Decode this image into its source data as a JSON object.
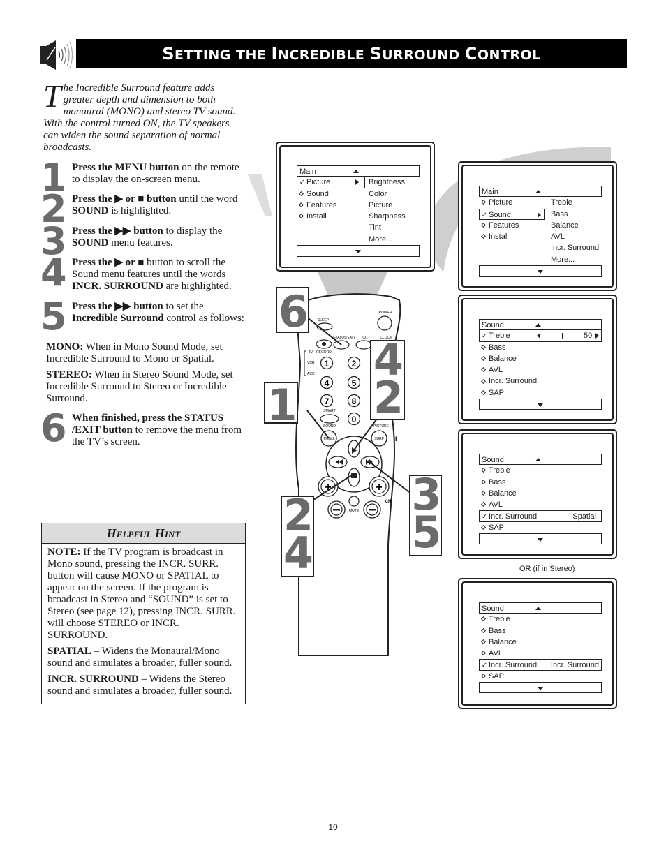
{
  "header": {
    "icon": "speaker-icon",
    "title_parts": [
      {
        "big": "S",
        "rest": "ETTING THE "
      },
      {
        "big": "I",
        "rest": "NCREDIBLE "
      },
      {
        "big": "S",
        "rest": "URROUND "
      },
      {
        "big": "C",
        "rest": "ONTROL"
      }
    ],
    "title": "Setting the Incredible Surround Control"
  },
  "intro": {
    "dropcap": "T",
    "text": "he Incredible Surround feature adds greater depth and dimension to both monaural (MONO) and stereo TV sound. With the control turned ON, the TV speakers can widen the sound separation of normal broadcasts."
  },
  "steps": [
    {
      "num": "1",
      "bold": "Press the MENU button",
      "rest": " on the remote to display the on-screen menu."
    },
    {
      "num": "2",
      "bold": "Press the ▶ or ■ button",
      "rest": " until the word ",
      "bold2": "SOUND",
      "rest2": " is highlighted."
    },
    {
      "num": "3",
      "bold": "Press the ▶▶ button",
      "rest": " to display the ",
      "bold2": "SOUND",
      "rest2": " menu features."
    },
    {
      "num": "4",
      "bold": "Press the ▶ or ■",
      "rest": " button to scroll the Sound menu features until the words ",
      "bold2": "INCR. SURROUND",
      "rest2": " are highlighted."
    },
    {
      "num": "5",
      "bold": "Press the ▶▶ button",
      "rest": " to set the ",
      "bold2": "Incredible Surround",
      "rest2": " control as follows:"
    },
    {
      "num": "6",
      "bold": "When finished, press the STATUS /EXIT button",
      "rest": " to remove the menu from the TV’s screen."
    }
  ],
  "modes": [
    {
      "label": "MONO:",
      "text": " When in Mono Sound Mode, set Incredible Surround to Mono or Spatial."
    },
    {
      "label": "STEREO:",
      "text": " When in Stereo Sound Mode, set Incredible Surround to Stereo or Incredible Surround."
    }
  ],
  "hint": {
    "title": "Helpful Hint",
    "note_label": "NOTE:",
    "note_text": "  If the TV program is broadcast in Mono sound, pressing the INCR. SURR. button will cause MONO or SPATIAL to appear on the screen. If the program is broadcast in Stereo and “SOUND” is set to Stereo (see page 12), pressing INCR. SURR. will choose STEREO or INCR. SURROUND.",
    "spatial_label": "SPATIAL",
    "spatial_text": " – Widens the Monaural/Mono sound and simulates a broader, fuller sound.",
    "incr_label": "INCR. SURROUND",
    "incr_text": " – Widens the Stereo sound and simulates a broader, fuller sound."
  },
  "screens": {
    "s1": {
      "header": "Main",
      "left": [
        {
          "label": "Picture",
          "mark": "check",
          "selected": true
        },
        {
          "label": "Sound",
          "mark": "diamond"
        },
        {
          "label": "Features",
          "mark": "diamond"
        },
        {
          "label": "Install",
          "mark": "diamond"
        }
      ],
      "right": [
        "Brightness",
        "Color",
        "Picture",
        "Sharpness",
        "Tint",
        "More..."
      ]
    },
    "s2": {
      "header": "Main",
      "left": [
        {
          "label": "Picture",
          "mark": "diamond"
        },
        {
          "label": "Sound",
          "mark": "check",
          "selected": true
        },
        {
          "label": "Features",
          "mark": "diamond"
        },
        {
          "label": "Install",
          "mark": "diamond"
        }
      ],
      "right": [
        "Treble",
        "Bass",
        "Balance",
        "AVL",
        "Incr. Surround",
        "More..."
      ]
    },
    "s3": {
      "header": "Sound",
      "items": [
        {
          "label": "Treble",
          "mark": "check",
          "selected": true,
          "slider_value": "50",
          "slider_fraction": 0.5
        },
        {
          "label": "Bass",
          "mark": "diamond"
        },
        {
          "label": "Balance",
          "mark": "diamond"
        },
        {
          "label": "AVL",
          "mark": "diamond"
        },
        {
          "label": "Incr. Surround",
          "mark": "diamond"
        },
        {
          "label": "SAP",
          "mark": "diamond"
        }
      ]
    },
    "s4": {
      "header": "Sound",
      "items": [
        {
          "label": "Treble",
          "mark": "diamond"
        },
        {
          "label": "Bass",
          "mark": "diamond"
        },
        {
          "label": "Balance",
          "mark": "diamond"
        },
        {
          "label": "AVL",
          "mark": "diamond"
        },
        {
          "label": "Incr. Surround",
          "mark": "check",
          "selected": true,
          "value": "Spatial"
        },
        {
          "label": "SAP",
          "mark": "diamond"
        }
      ]
    },
    "or_caption": "OR (if in Stereo)",
    "s5": {
      "header": "Sound",
      "items": [
        {
          "label": "Treble",
          "mark": "diamond"
        },
        {
          "label": "Bass",
          "mark": "diamond"
        },
        {
          "label": "Balance",
          "mark": "diamond"
        },
        {
          "label": "AVL",
          "mark": "diamond"
        },
        {
          "label": "Incr. Surround",
          "mark": "check",
          "selected": true,
          "value": "Incr. Surround"
        },
        {
          "label": "SAP",
          "mark": "diamond"
        }
      ]
    }
  },
  "remote": {
    "labels": {
      "power": "POWER",
      "sleep": "SLEEP",
      "status_exit": "STATUS/EXIT",
      "cc": "CC",
      "clock": "CLOCK",
      "record": "RECORD",
      "tv": "TV",
      "vcr": "VCR",
      "acc": "ACC",
      "smart": "SMART",
      "sound": "SOUND",
      "picture": "PICTURE",
      "menu": "MENU",
      "surf": "SURF",
      "mute": "MUTE",
      "ch": "CH"
    },
    "digits": [
      "1",
      "2",
      "4",
      "5",
      "7",
      "8",
      "0"
    ],
    "callouts": {
      "c6": "6",
      "c1": "1",
      "c42": [
        "4",
        "2"
      ],
      "c24": [
        "2",
        "4"
      ],
      "c35": [
        "3",
        "5"
      ]
    }
  },
  "page_number": "10"
}
